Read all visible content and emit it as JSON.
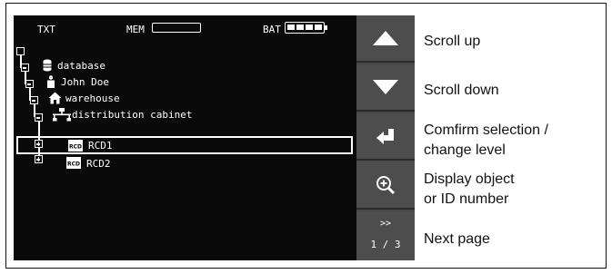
{
  "status_bar": {
    "txt": "TXT",
    "mem": "MEM",
    "bat": "BAT"
  },
  "tree": [
    {
      "label": "database",
      "icon": "database-icon"
    },
    {
      "label": "John Doe",
      "icon": "person-icon"
    },
    {
      "label": "warehouse",
      "icon": "house-icon"
    },
    {
      "label": "distribution cabinet",
      "icon": "network-icon"
    },
    {
      "label": "RCD1",
      "icon": "rcd-icon",
      "selected": true
    },
    {
      "label": "RCD2",
      "icon": "rcd-icon"
    }
  ],
  "panel": {
    "page_chevron": ">>",
    "page_indicator": "1 / 3"
  },
  "legend": {
    "scroll_up": "Scroll up",
    "scroll_down": "Scroll down",
    "confirm_line1": "Comfirm selection /",
    "confirm_line2": "change level",
    "display_line1": "Display object",
    "display_line2": "or ID number",
    "next_page": "Next page"
  },
  "colors": {
    "screen_bg": "#0a0a0a",
    "panel_bg": "#4a4a4a",
    "text_on_screen": "#ffffff"
  }
}
